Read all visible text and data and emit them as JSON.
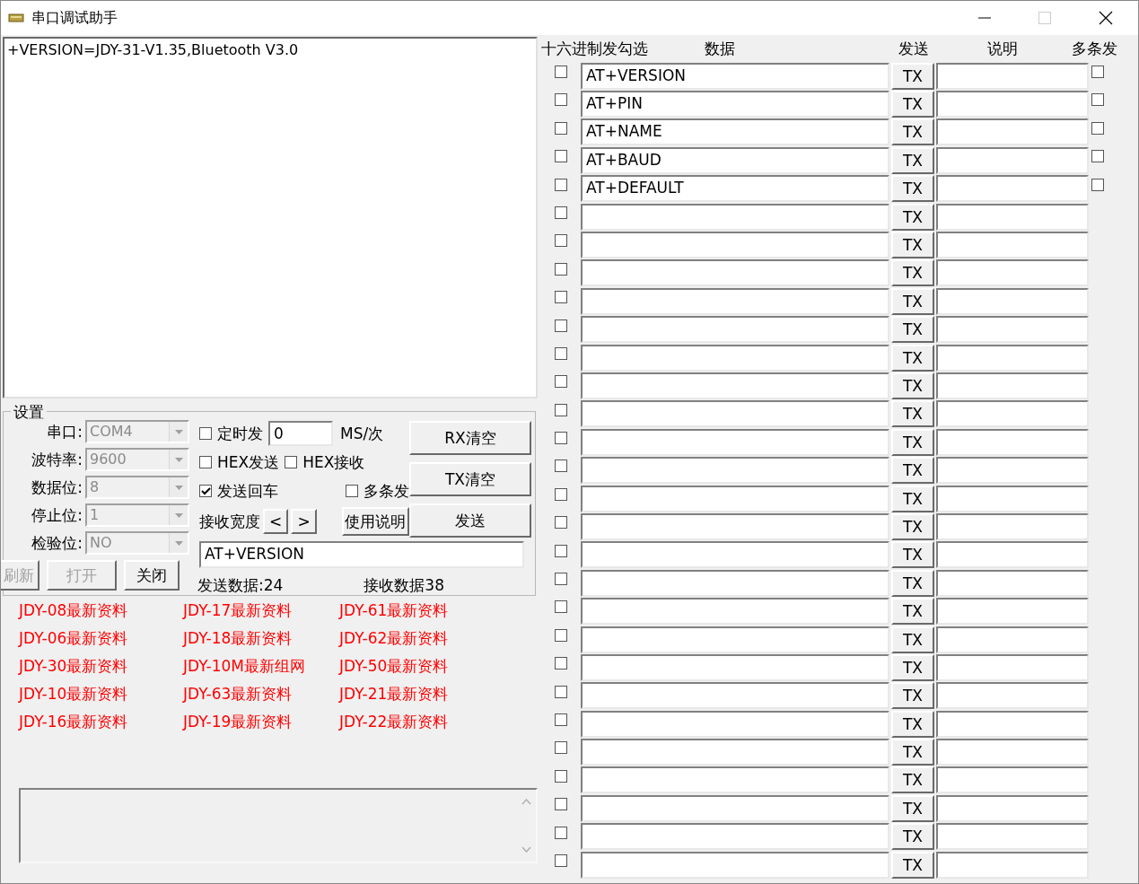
{
  "window": {
    "title": "串口调试助手"
  },
  "receive": {
    "text": "+VERSION=JDY-31-V1.35,Bluetooth V3.0"
  },
  "settings": {
    "title": "设置",
    "fields": [
      {
        "label": "串口:",
        "value": "COM4",
        "disabled": true
      },
      {
        "label": "波特率:",
        "value": "9600",
        "disabled": true
      },
      {
        "label": "数据位:",
        "value": "8",
        "disabled": true
      },
      {
        "label": "停止位:",
        "value": "1",
        "disabled": true
      },
      {
        "label": "检验位:",
        "value": "NO",
        "disabled": true
      }
    ],
    "port_buttons": [
      {
        "label": "刷新",
        "disabled": true
      },
      {
        "label": "打开",
        "disabled": true
      },
      {
        "label": "关闭",
        "disabled": false
      }
    ],
    "timed_send": {
      "label": "定时发",
      "checked": false,
      "value": "0",
      "unit": "MS/次"
    },
    "hex_send": {
      "label": "HEX发送",
      "checked": false
    },
    "hex_receive": {
      "label": "HEX接收",
      "checked": false
    },
    "send_newline": {
      "label": "发送回车",
      "checked": true
    },
    "multi_send": {
      "label": "多条发",
      "checked": false
    },
    "receive_width": {
      "label": "接收宽度",
      "buttons": [
        "<",
        ">"
      ]
    },
    "help_button": "使用说明",
    "action_buttons": [
      "RX清空",
      "TX清空",
      "发送"
    ],
    "send_input": {
      "value": "AT+VERSION"
    },
    "sent_count": "发送数据:24",
    "received_count": "接收数据38"
  },
  "links": [
    "JDY-08最新资料",
    "JDY-17最新资料",
    "JDY-61最新资料",
    "JDY-06最新资料",
    "JDY-18最新资料",
    "JDY-62最新资料",
    "JDY-30最新资料",
    "JDY-10M最新组网",
    "JDY-50最新资料",
    "JDY-10最新资料",
    "JDY-63最新资料",
    "JDY-21最新资料",
    "JDY-16最新资料",
    "JDY-19最新资料",
    "JDY-22最新资料"
  ],
  "command_table": {
    "columns": [
      "十六进制发勾选",
      "数据",
      "发送",
      "说明",
      "多条发"
    ],
    "rows": [
      {
        "hex": false,
        "data": "AT+VERSION",
        "button": "TX",
        "multi": false
      },
      {
        "hex": false,
        "data": "AT+PIN",
        "button": "TX",
        "multi": false
      },
      {
        "hex": false,
        "data": "AT+NAME",
        "button": "TX",
        "multi": false
      },
      {
        "hex": false,
        "data": "AT+BAUD",
        "button": "TX",
        "multi": false
      },
      {
        "hex": false,
        "data": "AT+DEFAULT",
        "button": "TX",
        "multi": false
      },
      {
        "hex": false,
        "button": "TX"
      },
      {
        "hex": false,
        "button": "TX"
      },
      {
        "hex": false,
        "button": "TX"
      },
      {
        "hex": false,
        "button": "TX"
      },
      {
        "hex": false,
        "button": "TX"
      },
      {
        "hex": false,
        "button": "TX"
      },
      {
        "hex": false,
        "button": "TX"
      },
      {
        "hex": false,
        "button": "TX"
      },
      {
        "hex": false,
        "button": "TX"
      },
      {
        "hex": false,
        "button": "TX"
      },
      {
        "hex": false,
        "button": "TX"
      },
      {
        "hex": false,
        "button": "TX"
      },
      {
        "hex": false,
        "button": "TX"
      },
      {
        "hex": false,
        "button": "TX"
      },
      {
        "hex": false,
        "button": "TX"
      },
      {
        "hex": false,
        "button": "TX"
      },
      {
        "hex": false,
        "button": "TX"
      },
      {
        "hex": false,
        "button": "TX"
      },
      {
        "hex": false,
        "button": "TX"
      },
      {
        "hex": false,
        "button": "TX"
      },
      {
        "hex": false,
        "button": "TX"
      },
      {
        "hex": false,
        "button": "TX"
      },
      {
        "hex": false,
        "button": "TX"
      },
      {
        "hex": false,
        "button": "TX"
      }
    ]
  }
}
